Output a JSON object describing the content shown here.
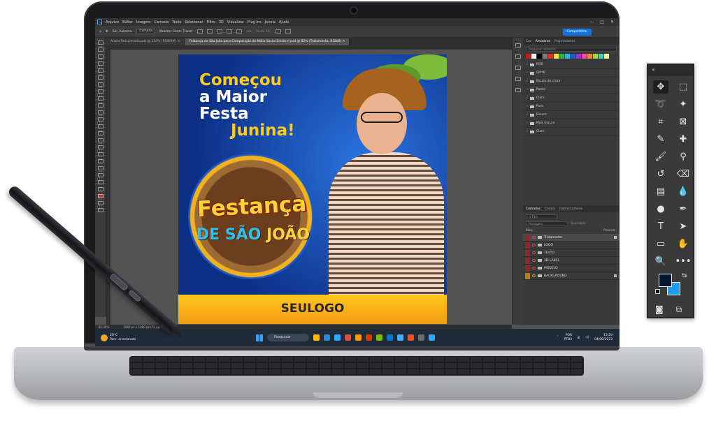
{
  "app": {
    "menu": [
      "Arquivo",
      "Editar",
      "Imagem",
      "Camada",
      "Texto",
      "Selecionar",
      "Filtro",
      "3D",
      "Visualizar",
      "Plug-ins",
      "Janela",
      "Ajuda"
    ],
    "window_controls": [
      "—",
      "□",
      "✕"
    ]
  },
  "options_bar": {
    "auto_select_label": "Sel. Automa.",
    "auto_select_value": "Camada",
    "show_transform_label": "Mostrar Contr. Transf.",
    "mode_3d_label": "Modo 3D:",
    "share_label": "Compartilhar"
  },
  "tabs": [
    {
      "label": "Arraia Recuperado.psb @ 150% (RGB/8#) ×"
    },
    {
      "label": "Festança de São João para Composição de Mídia Social Editável.psd @ 82% (Tratamento, RGB/8) ×"
    }
  ],
  "artwork": {
    "headline_1": "Começou",
    "headline_2": "a Maior Festa",
    "headline_3": "Junina!",
    "badge_title": "Festança",
    "badge_sub_1": "DE SÃO",
    "badge_sub_2": "JOÃO",
    "logo_text": "SEULOGO"
  },
  "swatches_panel": {
    "tabs": [
      "Cor",
      "Amostras",
      "Propriedades"
    ],
    "search_placeholder": "Pesquisar amostras",
    "swatch_colors": [
      "#c11d1d",
      "#ffffff",
      "#000000",
      "#7a7a7a",
      "#e52d2d",
      "#f7ea3a",
      "#2fb34a",
      "#2fb3e0",
      "#2455c6",
      "#9b33c4",
      "#ee49a7",
      "#ee8a2d",
      "#a8d23b",
      "#46d2c4",
      "#f0f0a0"
    ],
    "folders": [
      "RGB",
      "CMYK",
      "Escala de cinza",
      "Pastel",
      "Claro",
      "Puro",
      "Escuro",
      "Mais Escuro",
      "Claro"
    ]
  },
  "layers_panel": {
    "tabs": [
      "Camadas",
      "Canais",
      "Demarcadores"
    ],
    "filter_label": "Q Tipo",
    "blend_mode": "Passagem",
    "opacity_label": "Opacidade:",
    "lock_label": "Bloq.:",
    "fill_label": "Preench.:",
    "layers": [
      {
        "name": "Tratamento",
        "selected": true,
        "color": "red"
      },
      {
        "name": "LOGO",
        "selected": false,
        "color": "red"
      },
      {
        "name": "TEXTO",
        "selected": false,
        "color": "red"
      },
      {
        "name": "3D-LABEL",
        "selected": false,
        "color": "red"
      },
      {
        "name": "MODELO",
        "selected": false,
        "color": "red"
      },
      {
        "name": "BACKGROUND",
        "selected": false,
        "color": "yellow"
      }
    ]
  },
  "status": {
    "zoom": "82,39%",
    "doc_size": "1080 px x 1080 px (72 ppi)"
  },
  "taskbar": {
    "weather_temp": "20°C",
    "weather_desc": "Parc. ensolarado",
    "search_label": "Pesquisar",
    "language": "POR",
    "layout": "PTB2",
    "time": "13:29",
    "date": "04/06/2023",
    "app_colors": [
      "#ffb900",
      "#2b88d8",
      "#31a8ff",
      "#e34b3c",
      "#ff9a00",
      "#d83b01",
      "#7fba00",
      "#0078d4",
      "#44b0ff",
      "#f04e23",
      "#6c6c6c",
      "#31a8ff"
    ]
  },
  "floating_tools": {
    "collapse": "«",
    "tools": [
      {
        "name": "move-tool",
        "glyph": "✥",
        "active": true
      },
      {
        "name": "marquee-tool",
        "glyph": "⬚",
        "active": false
      },
      {
        "name": "lasso-tool",
        "glyph": "➰",
        "active": false
      },
      {
        "name": "magic-wand-tool",
        "glyph": "✦",
        "active": false
      },
      {
        "name": "crop-tool",
        "glyph": "⌗",
        "active": false
      },
      {
        "name": "frame-tool",
        "glyph": "⊠",
        "active": false
      },
      {
        "name": "eyedropper-tool",
        "glyph": "✎",
        "active": false
      },
      {
        "name": "healing-tool",
        "glyph": "✚",
        "active": false
      },
      {
        "name": "brush-tool",
        "glyph": "🖌",
        "active": false
      },
      {
        "name": "stamp-tool",
        "glyph": "⚲",
        "active": false
      },
      {
        "name": "history-brush-tool",
        "glyph": "↺",
        "active": false
      },
      {
        "name": "eraser-tool",
        "glyph": "⌫",
        "active": false
      },
      {
        "name": "gradient-tool",
        "glyph": "▤",
        "active": false
      },
      {
        "name": "blur-tool",
        "glyph": "💧",
        "active": false
      },
      {
        "name": "dodge-tool",
        "glyph": "●",
        "active": false
      },
      {
        "name": "pen-tool",
        "glyph": "✒",
        "active": false
      },
      {
        "name": "type-tool",
        "glyph": "T",
        "active": false
      },
      {
        "name": "path-select-tool",
        "glyph": "➤",
        "active": false
      },
      {
        "name": "rectangle-tool",
        "glyph": "▭",
        "active": false
      },
      {
        "name": "hand-tool",
        "glyph": "✋",
        "active": false
      },
      {
        "name": "zoom-tool",
        "glyph": "🔍",
        "active": false
      },
      {
        "name": "more-tools",
        "glyph": "•••",
        "active": false
      }
    ],
    "foreground_color": "#07162f",
    "background_color": "#1e9bf5"
  }
}
